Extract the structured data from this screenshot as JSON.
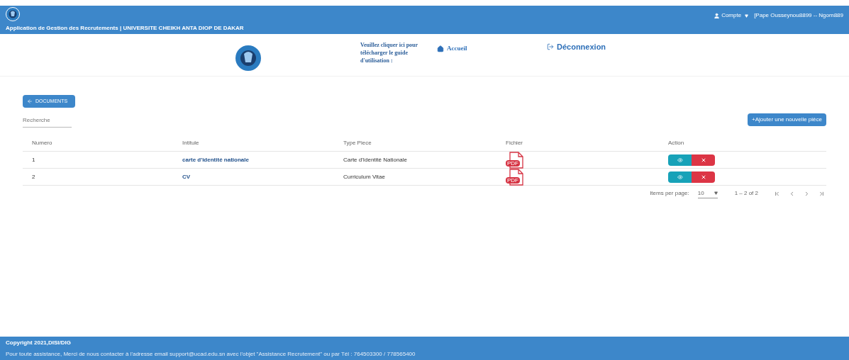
{
  "header": {
    "title": "Application de Gestion des Recrutements | UNIVERSITE CHEIKH ANTA DIOP DE DAKAR",
    "account": "Compte",
    "user": "[Pape Ousseynou8899 -- Ngom889"
  },
  "subheader": {
    "guide": "Veuillez cliquer ici pour télécharger le guide d'utilisation :",
    "home": "Accueil",
    "logout": "Déconnexion"
  },
  "back_button": "DOCUMENTS",
  "add_button": "+Ajouter une nouvelle pièce",
  "search": {
    "placeholder": "Recherche"
  },
  "table": {
    "columns": [
      "Numero",
      "Intitule",
      "Type Piece",
      "Fichier",
      "Action"
    ],
    "rows": [
      {
        "number": "1",
        "title": "carte d'identité nationale",
        "type": "Carte d'Identité Nationale",
        "file": "PDF"
      },
      {
        "number": "2",
        "title": "CV",
        "type": "Curriculum Vitae",
        "file": "PDF"
      }
    ]
  },
  "paginator": {
    "label": "Items per page:",
    "page_size": "10",
    "range": "1 – 2 of 2"
  },
  "footer": {
    "copyright": "Copyright 2021,DISI/DIG",
    "contact": "Pour toute assistance, Merci de nous contacter à l'adresse email support@ucad.edu.sn avec l'objet \"Assistance Recrutement\" ou par Tél : 764503300 / 778565400"
  }
}
